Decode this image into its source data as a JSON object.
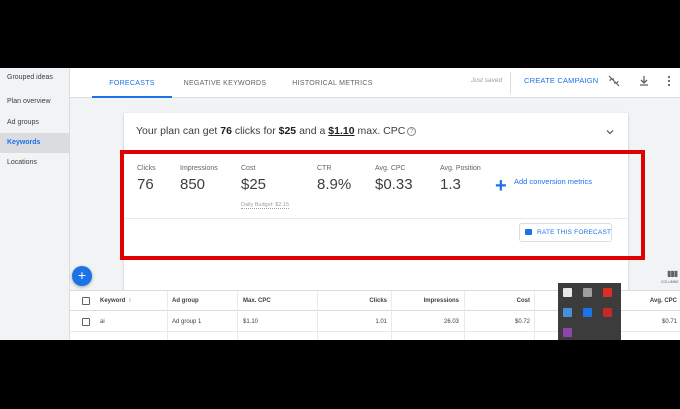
{
  "sidebar": {
    "items": [
      {
        "label": "Grouped ideas"
      },
      {
        "label": "Plan overview"
      },
      {
        "label": "Ad groups"
      },
      {
        "label": "Keywords"
      },
      {
        "label": "Locations"
      }
    ],
    "active_index": 3
  },
  "topbar": {
    "tabs": [
      {
        "label": "FORECASTS"
      },
      {
        "label": "NEGATIVE KEYWORDS"
      },
      {
        "label": "HISTORICAL METRICS"
      }
    ],
    "active_tab": "FORECASTS",
    "status_text": "Just saved",
    "create_label": "CREATE CAMPAIGN",
    "icons": [
      "link-off-icon",
      "download-icon",
      "more-vert-icon"
    ]
  },
  "forecast": {
    "summary": {
      "prefix": "Your plan can get ",
      "clicks": "76",
      "mid1": " clicks for ",
      "cost": "$25",
      "mid2": " and a ",
      "cpc": "$1.10",
      "suffix": " max. CPC"
    },
    "metrics": [
      {
        "label": "Clicks",
        "value": "76"
      },
      {
        "label": "Impressions",
        "value": "850"
      },
      {
        "label": "Cost",
        "value": "$25",
        "sub": "Daily Budget: $2.15"
      },
      {
        "label": "CTR",
        "value": "8.9%"
      },
      {
        "label": "Avg. CPC",
        "value": "$0.33"
      },
      {
        "label": "Avg. Position",
        "value": "1.3"
      }
    ],
    "add_conversion_label": "Add conversion metrics",
    "rate_label": "RATE THIS FORECAST"
  },
  "table": {
    "columns_label": "COLUMNS",
    "headers": [
      "Keyword",
      "Ad group",
      "Max. CPC",
      "Clicks",
      "Impressions",
      "Cost",
      "Avg. CPC"
    ],
    "rows": [
      [
        "ai",
        "Ad group 1",
        "$1.10",
        "1.01",
        "26.03",
        "$0.72",
        "$0.71"
      ]
    ]
  },
  "colors": {
    "accent": "#1a73e8",
    "highlight": "#e00000",
    "background": "#f1f3f4"
  }
}
